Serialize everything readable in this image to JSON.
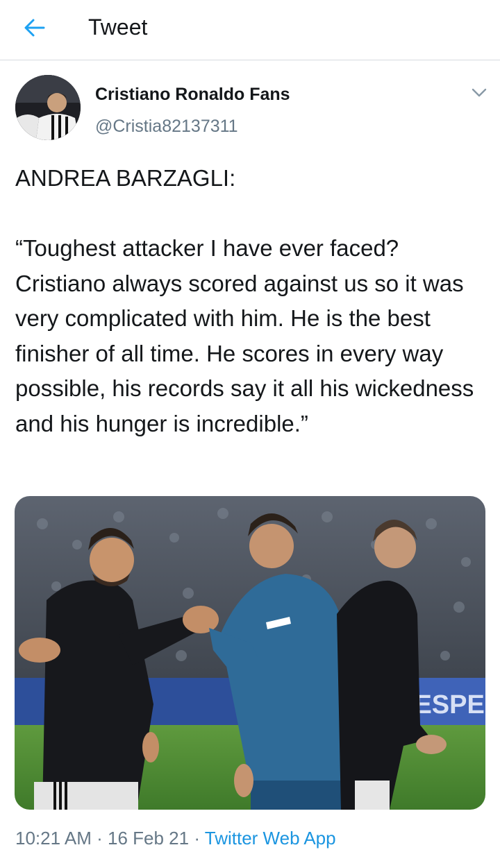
{
  "header": {
    "title": "Tweet",
    "back_icon": "back-arrow-icon"
  },
  "author": {
    "display_name": "Cristiano Ronaldo Fans",
    "handle": "@Cristia82137311",
    "more_icon": "chevron-down-icon"
  },
  "tweet": {
    "text": "ANDREA BARZAGLI:\n\n“Toughest attacker I have ever faced? Cristiano always scored against us so it was very complicated with him. He is the best finisher of all time. He scores in every way possible, his records say it all his wickedness and his hunger is incredible.”",
    "media": {
      "banner_text": "RESPEC"
    }
  },
  "meta": {
    "time": "10:21 AM",
    "separator": "·",
    "date": "16 Feb 21",
    "source": "Twitter Web App"
  },
  "colors": {
    "accent": "#1da1f2",
    "link": "#1b95e0",
    "secondary_text": "#657786",
    "divider": "#d6dbe0"
  }
}
